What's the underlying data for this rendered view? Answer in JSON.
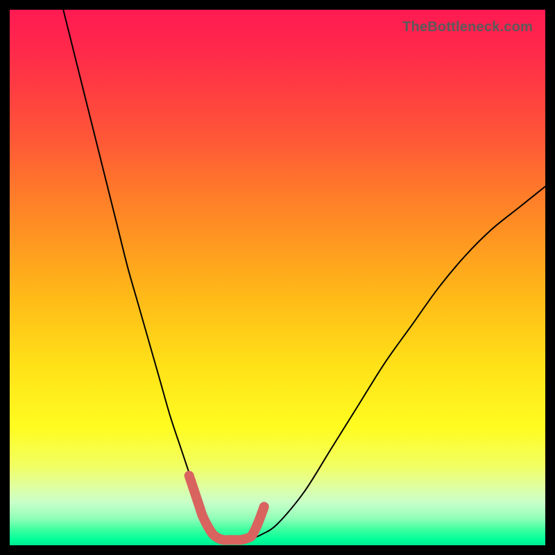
{
  "attribution": "TheBottleneck.com",
  "chart_data": {
    "type": "line",
    "title": "",
    "xlabel": "",
    "ylabel": "",
    "xlim": [
      0,
      100
    ],
    "ylim": [
      0,
      100
    ],
    "series": [
      {
        "name": "bottleneck-curve",
        "x": [
          10,
          12,
          14,
          16,
          18,
          20,
          22,
          24,
          26,
          28,
          30,
          32,
          34,
          35,
          36,
          37,
          38,
          39,
          40,
          41,
          42,
          43,
          44,
          45,
          47,
          50,
          55,
          60,
          65,
          70,
          75,
          80,
          85,
          90,
          95,
          100
        ],
        "values": [
          100,
          92,
          84,
          76,
          68,
          60,
          52,
          45,
          38,
          31,
          24,
          18,
          12,
          9,
          7,
          5,
          3,
          2,
          1.5,
          1.2,
          1,
          1,
          1,
          1.2,
          2,
          4,
          10,
          18,
          26,
          34,
          41,
          48,
          54,
          59,
          63,
          67
        ]
      }
    ],
    "highlight": {
      "name": "highlight-band",
      "x": [
        33.5,
        34.0,
        34.5,
        35.0,
        35.5,
        36.0,
        37.0,
        38.0,
        39.0,
        40.0,
        41.0,
        42.0,
        43.0,
        44.0,
        45.0,
        45.5,
        46.0,
        46.5,
        47.0,
        47.5
      ],
      "values": [
        13,
        11.5,
        10,
        8.5,
        7,
        5.5,
        3.5,
        2,
        1.3,
        1,
        1,
        1,
        1,
        1.2,
        1.6,
        2.3,
        3.3,
        4.5,
        5.8,
        7.2
      ]
    },
    "colors": {
      "gradient_top": "#ff1a52",
      "gradient_bottom": "#00e890",
      "curve": "#000000",
      "highlight": "#d8635f"
    }
  }
}
